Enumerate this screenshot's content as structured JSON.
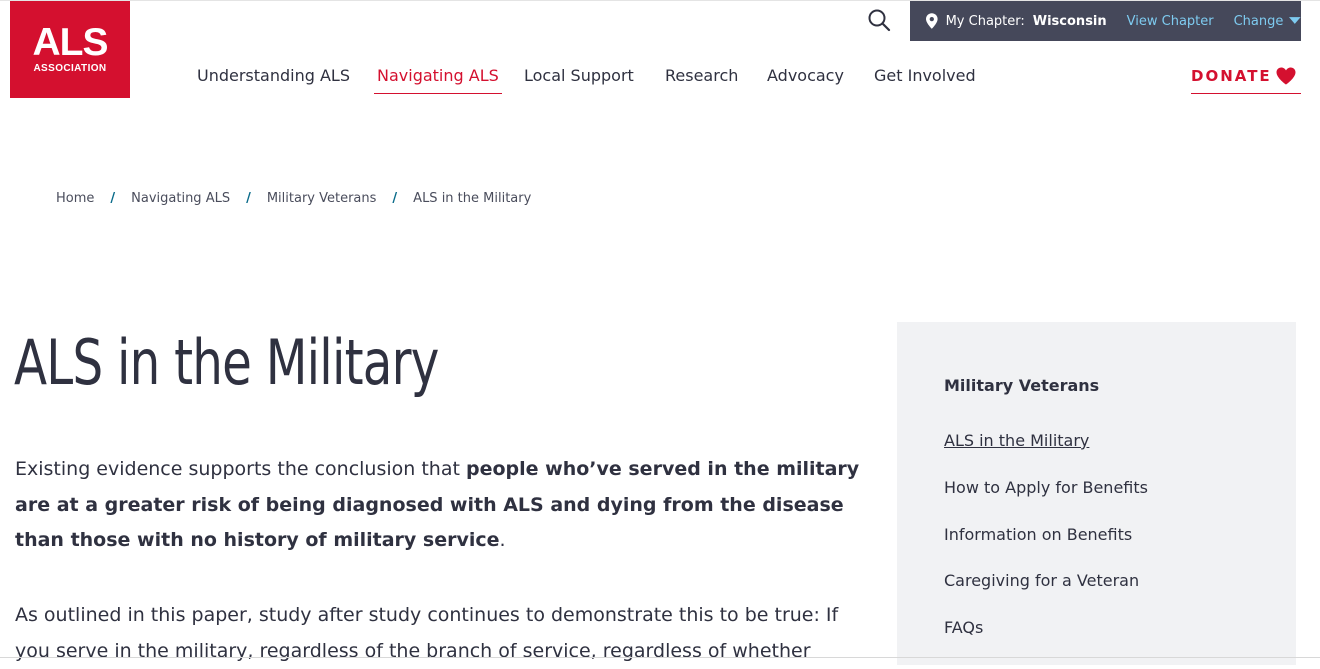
{
  "logo": {
    "main": "ALS",
    "sub": "ASSOCIATION",
    "color": "#d4102f"
  },
  "header": {
    "search_icon": "search-icon",
    "chapter": {
      "label": "My Chapter:",
      "name": "Wisconsin",
      "view_label": "View Chapter",
      "change_label": "Change"
    }
  },
  "nav": {
    "items": [
      {
        "label": "Understanding ALS"
      },
      {
        "label": "Navigating ALS",
        "active": true
      },
      {
        "label": "Local Support"
      },
      {
        "label": "Research"
      },
      {
        "label": "Advocacy"
      },
      {
        "label": "Get Involved"
      }
    ],
    "donate_label": "DONATE"
  },
  "breadcrumb": {
    "items": [
      "Home",
      "Navigating ALS",
      "Military Veterans",
      "ALS in the Military"
    ],
    "separator": "/"
  },
  "page": {
    "title": "ALS in the Military",
    "intro_start": "Existing evidence supports the conclusion that ",
    "intro_bold": "people who’ve served in the military are at a greater risk of being diagnosed with ALS and dying from the disease than those with no history of military service",
    "intro_end": ".",
    "para2": "As outlined in this paper, study after study continues to demonstrate this to be true: If you serve in the military, regardless of the branch of service, regardless of whether"
  },
  "sidebar": {
    "heading": "Military Veterans",
    "links": [
      {
        "label": "ALS in the Military",
        "current": true
      },
      {
        "label": "How to Apply for Benefits"
      },
      {
        "label": "Information on Benefits"
      },
      {
        "label": "Caregiving for a Veteran"
      },
      {
        "label": "FAQs"
      }
    ]
  },
  "colors": {
    "brand_red": "#d4102f",
    "chapter_bar": "#45485a",
    "chapter_link": "#7ecbf0",
    "text": "#2f3140",
    "sidebar_bg": "#f1f2f4"
  }
}
